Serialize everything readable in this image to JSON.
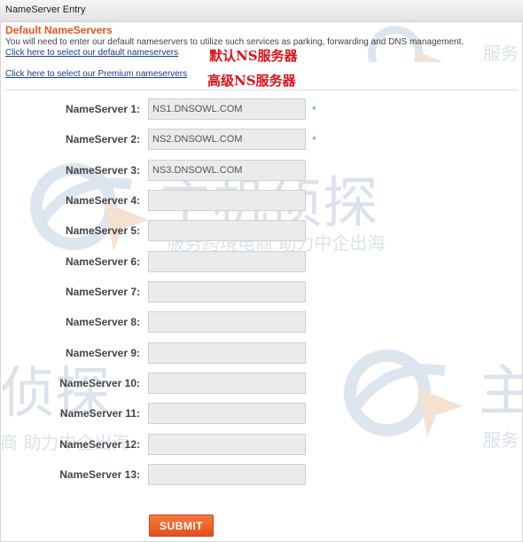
{
  "window": {
    "title": "NameServer Entry"
  },
  "section": {
    "title": "Default NameServers",
    "intro": "You will need to enter our default nameservers to utilize such services as parking, forwarding and DNS management."
  },
  "links": {
    "default_ns": "Click here to select our default nameservers",
    "premium_ns": "Click here to select our Premium nameservers"
  },
  "annotations": {
    "default_ns": "默认NS服务器",
    "premium_ns": "高级NS服务器"
  },
  "nameservers": [
    {
      "label": "NameServer 1:",
      "value": "NS1.DNSOWL.COM",
      "required": "*"
    },
    {
      "label": "NameServer 2:",
      "value": "NS2.DNSOWL.COM",
      "required": "*"
    },
    {
      "label": "NameServer 3:",
      "value": "NS3.DNSOWL.COM",
      "required": ""
    },
    {
      "label": "NameServer 4:",
      "value": "",
      "required": ""
    },
    {
      "label": "NameServer 5:",
      "value": "",
      "required": ""
    },
    {
      "label": "NameServer 6:",
      "value": "",
      "required": ""
    },
    {
      "label": "NameServer 7:",
      "value": "",
      "required": ""
    },
    {
      "label": "NameServer 8:",
      "value": "",
      "required": ""
    },
    {
      "label": "NameServer 9:",
      "value": "",
      "required": ""
    },
    {
      "label": "NameServer 10:",
      "value": "",
      "required": ""
    },
    {
      "label": "NameServer 11:",
      "value": "",
      "required": ""
    },
    {
      "label": "NameServer 12:",
      "value": "",
      "required": ""
    },
    {
      "label": "NameServer 13:",
      "value": "",
      "required": ""
    }
  ],
  "submit_label": "SUBMIT",
  "watermark": {
    "brand": "主机侦探",
    "slogan": "服务跨境电商 助力中企出海",
    "slogan_left_fragment": "商 助力中企出海",
    "brand_right_fragment": "主",
    "slogan_right_fragment": "服务",
    "brand_left_fragment": "侦探",
    "icon": "search-globe-logo-icon",
    "color": "#dbe2ea"
  },
  "colors": {
    "accent": "#e8561c",
    "link": "#1a3c8c",
    "annotation": "#e0101a",
    "required_mark": "#3a8ee0"
  }
}
